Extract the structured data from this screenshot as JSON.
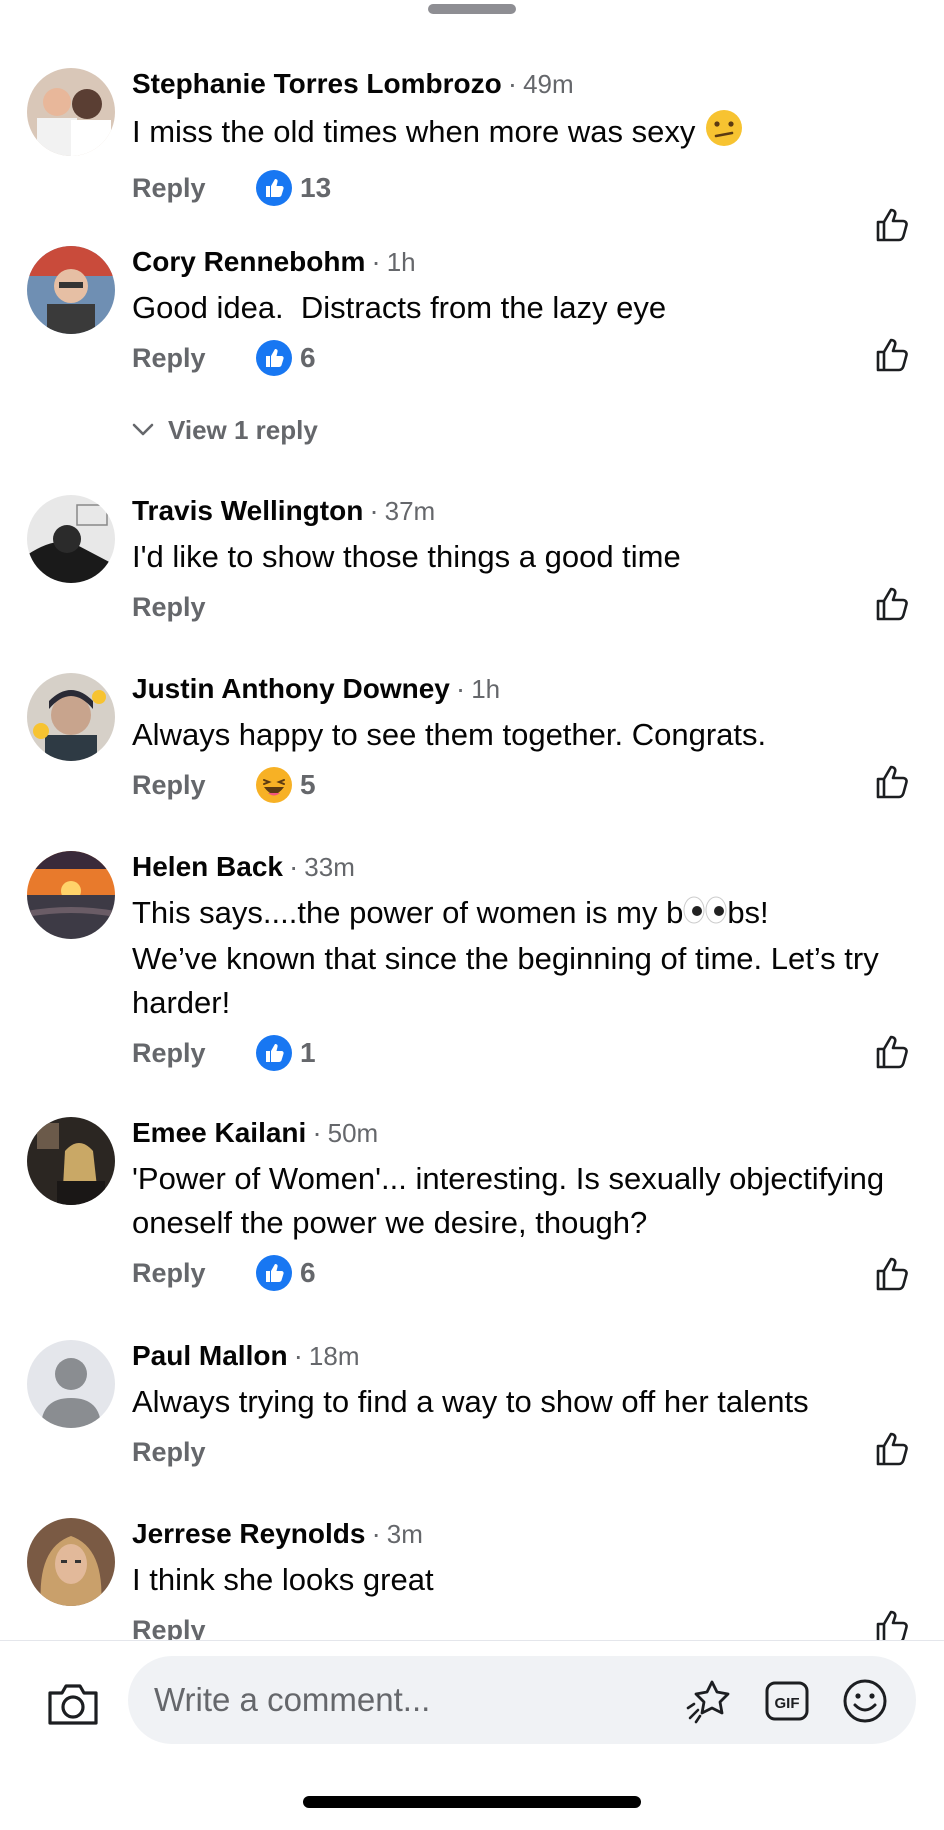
{
  "comments": [
    {
      "author": "Stephanie Torres Lombrozo",
      "time": "49m",
      "text": "I miss the old times when more was sexy",
      "reply": "Reply",
      "reaction": "like",
      "count": "13"
    },
    {
      "author": "Cory Rennebohm",
      "time": "1h",
      "text": "Good idea.  Distracts from the lazy eye",
      "reply": "Reply",
      "reaction": "like",
      "count": "6",
      "view_replies": "View 1 reply"
    },
    {
      "author": "Travis Wellington",
      "time": "37m",
      "text": "I'd like to show those things a good time",
      "reply": "Reply"
    },
    {
      "author": "Justin Anthony Downey",
      "time": "1h",
      "text": "Always happy to see them together. Congrats.",
      "reply": "Reply",
      "reaction": "haha",
      "count": "5"
    },
    {
      "author": "Helen Back",
      "time": "33m",
      "text_part1": "This says....the power of women is my b",
      "text_part2": "bs!",
      "text_rest": "We’ve known that since the beginning of time. Let’s try harder!",
      "reply": "Reply",
      "reaction": "like",
      "count": "1"
    },
    {
      "author": "Emee Kailani",
      "time": "50m",
      "text": "'Power of Women'... interesting. Is sexually objectifying oneself the power we desire, though?",
      "reply": "Reply",
      "reaction": "like",
      "count": "6"
    },
    {
      "author": "Paul Mallon",
      "time": "18m",
      "text": "Always trying to find a way to show off her talents",
      "reply": "Reply"
    },
    {
      "author": "Jerrese Reynolds",
      "time": "3m",
      "text": "I think she looks great",
      "reply": "Reply"
    }
  ],
  "separator": "·",
  "composer": {
    "placeholder": "Write a comment...",
    "gif_label": "GIF"
  },
  "colors": {
    "like_blue": "#1877f2",
    "meta_gray": "#65676b",
    "pill_bg": "#f0f2f5"
  }
}
